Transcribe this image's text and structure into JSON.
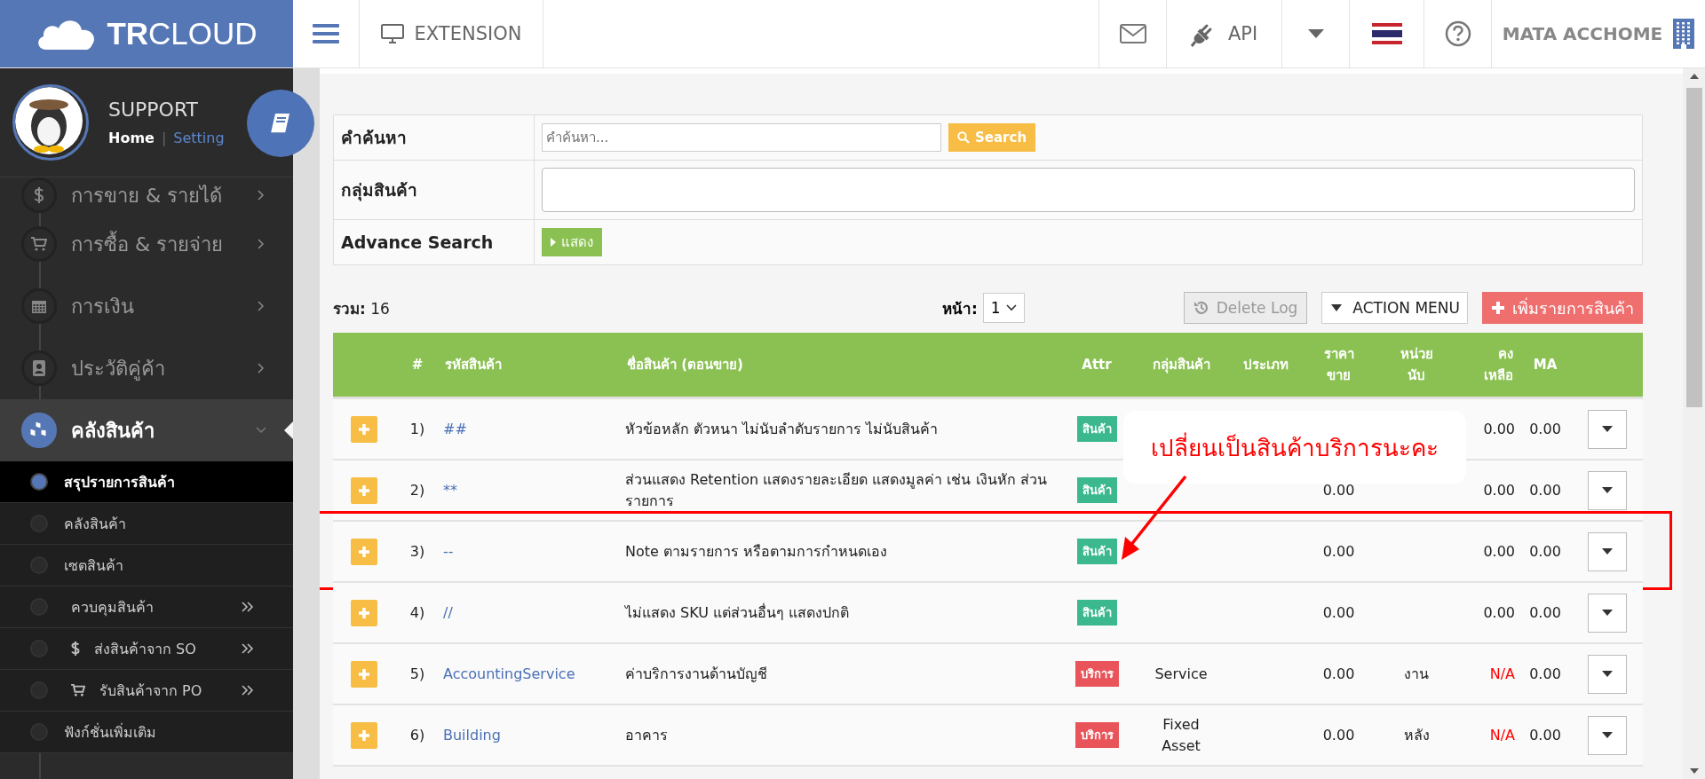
{
  "brand": {
    "logo_bold": "TR",
    "logo_rest": "CLOUD"
  },
  "topbar": {
    "extension": "EXTENSION",
    "api": "API",
    "company": "MATA ACCHOME"
  },
  "profile": {
    "name": "SUPPORT",
    "home": "Home",
    "separator": "|",
    "setting": "Setting"
  },
  "sidebar": {
    "items": [
      {
        "label": "การขาย & รายได้",
        "expanded": false
      },
      {
        "label": "การซื้อ & รายจ่าย",
        "expanded": false
      },
      {
        "label": "การเงิน",
        "expanded": false
      },
      {
        "label": "ประวัติคู่ค้า",
        "expanded": false
      },
      {
        "label": "คลังสินค้า",
        "expanded": true,
        "children": [
          {
            "label": "สรุปรายการสินค้า",
            "selected": true,
            "has_submenu": false
          },
          {
            "label": "คลังสินค้า",
            "selected": false,
            "has_submenu": false
          },
          {
            "label": "เซตสินค้า",
            "selected": false,
            "has_submenu": false
          },
          {
            "label": "ควบคุมสินค้า",
            "selected": false,
            "has_submenu": true
          },
          {
            "label": "ส่งสินค้าจาก SO",
            "selected": false,
            "has_submenu": true
          },
          {
            "label": "รับสินค้าจาก PO",
            "selected": false,
            "has_submenu": true
          },
          {
            "label": "ฟังก์ชั่นเพิ่มเติม",
            "selected": false,
            "has_submenu": false
          }
        ]
      }
    ]
  },
  "search": {
    "keyword_label": "คำค้นหา",
    "keyword_placeholder": "คำค้นหา...",
    "search_button": "Search",
    "group_label": "กลุ่มสินค้า",
    "advance_label": "Advance Search",
    "advance_button": "แสดง"
  },
  "toolbar": {
    "total": "**รวม:** 16",
    "page_label": "หน้า:",
    "page_value": "1",
    "delete_log": "Delete Log",
    "delete_log_disabled": true,
    "action_menu": "ACTION MENU",
    "add_button": "เพิ่มรายการสินค้า"
  },
  "table": {
    "columns": [
      "#",
      "รหัสสินค้า",
      "ชื่อสินค้า (ตอนขาย)",
      "Attr",
      "กลุ่มสินค้า",
      "ประเภท",
      "ราคา ขาย",
      "หน่วย นับ",
      "คง เหลือ",
      "MA"
    ],
    "rows": [
      {
        "no": "1)",
        "code": "##",
        "name": "หัวข้อหลัก ตัวหนา ไม่นับลำดับรายการ ไม่นับสินค้า",
        "attr": {
          "label": "สินค้า",
          "color": "#3cb88f"
        },
        "stock": "0.00",
        "stock_warning": false,
        "ma": "0.00",
        "highlighted": false
      },
      {
        "no": "2)",
        "code": "**",
        "name": "ส่วนแสดง Retention แสดงรายละเอียด แสดงมูลค่า เช่น เงินหัก ส่วนรายการ",
        "attr": {
          "label": "สินค้า",
          "color": "#3cb88f"
        },
        "price": "0.00",
        "stock": "0.00",
        "stock_warning": false,
        "ma": "0.00",
        "highlighted": false
      },
      {
        "no": "3)",
        "code": "--",
        "name": "Note ตามรายการ หรือตามการกำหนดเอง",
        "attr": {
          "label": "สินค้า",
          "color": "#3cb88f"
        },
        "price": "0.00",
        "stock": "0.00",
        "stock_warning": false,
        "ma": "0.00",
        "highlighted": true
      },
      {
        "no": "4)",
        "code": "//",
        "name": "ไม่แสดง SKU แต่ส่วนอื่นๆ แสดงปกติ",
        "attr": {
          "label": "สินค้า",
          "color": "#3cb88f"
        },
        "price": "0.00",
        "stock": "0.00",
        "stock_warning": false,
        "ma": "0.00",
        "highlighted": false
      },
      {
        "no": "5)",
        "code": "AccountingService",
        "name": "ค่าบริการงานด้านบัญชี",
        "attr": {
          "label": "บริการ",
          "color": "#e8545a"
        },
        "group": "Service",
        "price": "0.00",
        "unit": "งาน",
        "stock": "N/A",
        "stock_warning": true,
        "ma": "0.00",
        "highlighted": false
      },
      {
        "no": "6)",
        "code": "Building",
        "name": "อาคาร",
        "attr": {
          "label": "บริการ",
          "color": "#e8545a"
        },
        "group": "Fixed Asset",
        "price": "0.00",
        "unit": "หลัง",
        "stock": "N/A",
        "stock_warning": true,
        "ma": "0.00",
        "highlighted": false
      }
    ]
  },
  "annotation": {
    "text": "เปลี่ยนเป็นสินค้าบริการนะคะ"
  }
}
